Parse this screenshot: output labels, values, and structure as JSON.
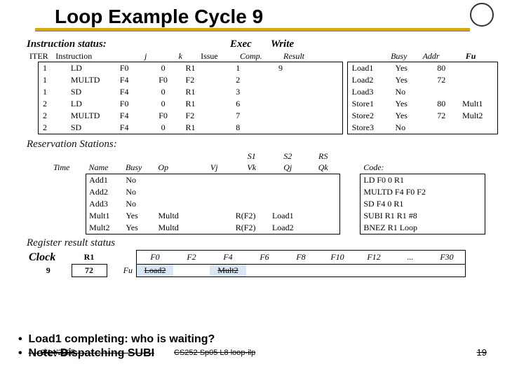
{
  "title": "Loop Example Cycle 9",
  "logo": "",
  "sections": {
    "instr_status": "Instruction status:",
    "exec": "Exec",
    "write": "Write",
    "res_stations": "Reservation Stations:",
    "reg_result": "Register result status"
  },
  "is": {
    "head": {
      "iter": "ITER",
      "instr": "Instruction",
      "j": "j",
      "k": "k",
      "issue": "Issue",
      "comp": "Comp.",
      "result": "Result",
      "busy": "Busy",
      "addr": "Addr",
      "fu": "Fu"
    },
    "rows": [
      {
        "iter": "1",
        "instr": "LD",
        "rd": "F0",
        "j": "0",
        "k": "R1",
        "issue": "1",
        "comp": "9",
        "wr": "",
        "name": "Load1",
        "busy": "Yes",
        "addr": "80",
        "fu": ""
      },
      {
        "iter": "1",
        "instr": "MULTD",
        "rd": "F4",
        "j": "F0",
        "k": "F2",
        "issue": "2",
        "comp": "",
        "wr": "",
        "name": "Load2",
        "busy": "Yes",
        "addr": "72",
        "fu": ""
      },
      {
        "iter": "1",
        "instr": "SD",
        "rd": "F4",
        "j": "0",
        "k": "R1",
        "issue": "3",
        "comp": "",
        "wr": "",
        "name": "Load3",
        "busy": "No",
        "addr": "",
        "fu": ""
      },
      {
        "iter": "2",
        "instr": "LD",
        "rd": "F0",
        "j": "0",
        "k": "R1",
        "issue": "6",
        "comp": "",
        "wr": "",
        "name": "Store1",
        "busy": "Yes",
        "addr": "80",
        "fu": "Mult1"
      },
      {
        "iter": "2",
        "instr": "MULTD",
        "rd": "F4",
        "j": "F0",
        "k": "F2",
        "issue": "7",
        "comp": "",
        "wr": "",
        "name": "Store2",
        "busy": "Yes",
        "addr": "72",
        "fu": "Mult2"
      },
      {
        "iter": "2",
        "instr": "SD",
        "rd": "F4",
        "j": "0",
        "k": "R1",
        "issue": "8",
        "comp": "",
        "wr": "",
        "name": "Store3",
        "busy": "No",
        "addr": "",
        "fu": ""
      }
    ]
  },
  "rs": {
    "head": {
      "time": "Time",
      "name": "Name",
      "busy": "Busy",
      "op": "Op",
      "vj": "Vj",
      "vk": "Vk",
      "s1": "S1",
      "s2": "S2",
      "rs": "RS",
      "qj": "Qj",
      "qk": "Qk",
      "code": "Code:"
    },
    "rows": [
      {
        "time": "",
        "name": "Add1",
        "busy": "No",
        "op": "",
        "vj": "",
        "vk": "",
        "qj": "",
        "qk": ""
      },
      {
        "time": "",
        "name": "Add2",
        "busy": "No",
        "op": "",
        "vj": "",
        "vk": "",
        "qj": "",
        "qk": ""
      },
      {
        "time": "",
        "name": "Add3",
        "busy": "No",
        "op": "",
        "vj": "",
        "vk": "",
        "qj": "",
        "qk": ""
      },
      {
        "time": "",
        "name": "Mult1",
        "busy": "Yes",
        "op": "Multd",
        "vj": "",
        "vk": "R(F2)",
        "qj": "Load1",
        "qk": ""
      },
      {
        "time": "",
        "name": "Mult2",
        "busy": "Yes",
        "op": "Multd",
        "vj": "",
        "vk": "R(F2)",
        "qj": "Load2",
        "qk": ""
      }
    ],
    "code": [
      [
        "LD",
        "F0",
        "0",
        "R1"
      ],
      [
        "MULTD",
        "F4",
        "F0",
        "F2"
      ],
      [
        "SD",
        "F4",
        "0",
        "R1"
      ],
      [
        "SUBI",
        "R1",
        "R1",
        "#8"
      ],
      [
        "BNEZ",
        "R1",
        "Loop",
        ""
      ]
    ]
  },
  "reg": {
    "clock_lbl": "Clock",
    "clock": "9",
    "r1": "R1",
    "r1v": "72",
    "fu": "Fu",
    "cols": [
      "F0",
      "F2",
      "F4",
      "F6",
      "F8",
      "F10",
      "F12",
      "...",
      "F30"
    ],
    "vals": [
      "Load2",
      "",
      "Mult2",
      "",
      "",
      "",
      "",
      "",
      ""
    ],
    "struck": [
      true,
      false,
      true,
      false,
      false,
      false,
      false,
      false,
      false
    ]
  },
  "bullets": {
    "b1": "Load1 completing: who is waiting?",
    "b2": "Note: Dispatching SUBI"
  },
  "footer": {
    "date": "2/14/2005",
    "mid": "CS252 Sp05 L8 loop-ilp",
    "page": "19"
  }
}
